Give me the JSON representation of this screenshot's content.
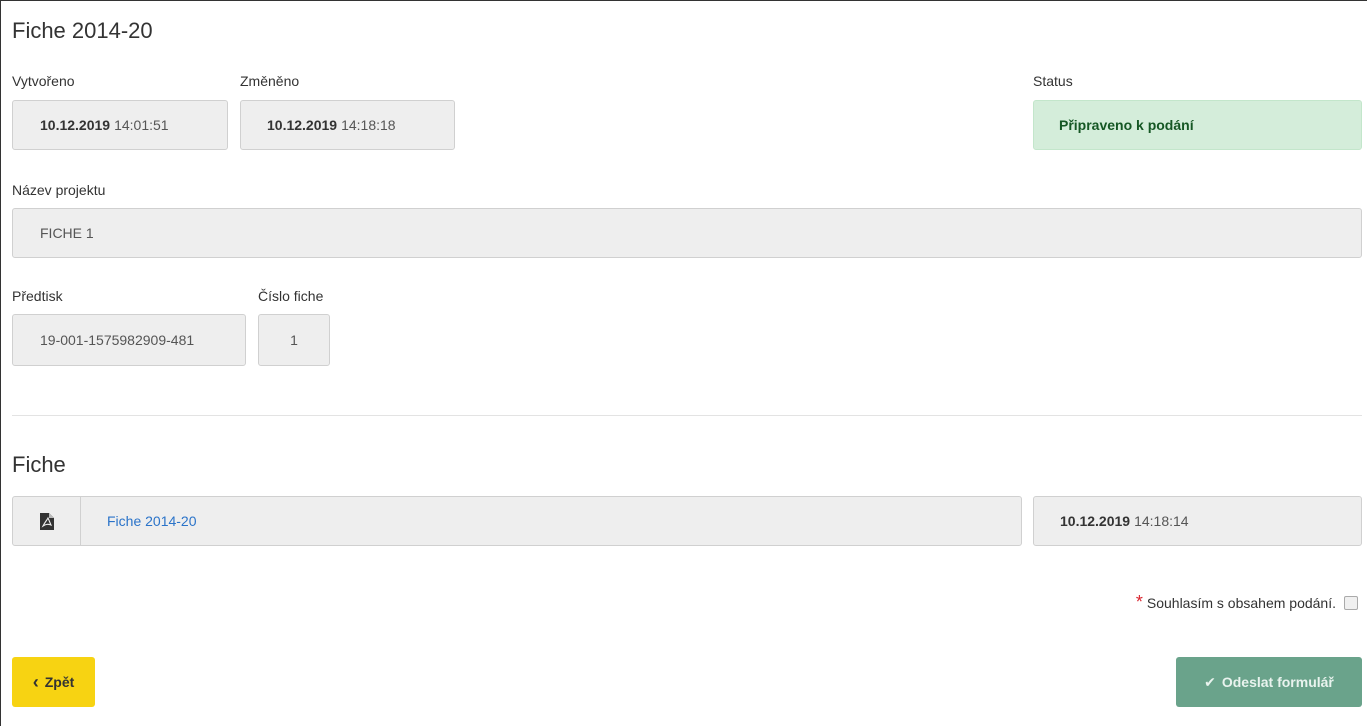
{
  "header": {
    "title": "Fiche 2014-20"
  },
  "created": {
    "label": "Vytvořeno",
    "date": "10.12.2019",
    "time": "14:01:51"
  },
  "changed": {
    "label": "Změněno",
    "date": "10.12.2019",
    "time": "14:18:18"
  },
  "status": {
    "label": "Status",
    "value": "Připraveno k podání"
  },
  "project": {
    "label": "Název projektu",
    "value": "FICHE 1"
  },
  "predtisk": {
    "label": "Předtisk",
    "value": "19-001-1575982909-481"
  },
  "cislo": {
    "label": "Číslo fiche",
    "value": "1"
  },
  "fiche_section": {
    "title": "Fiche",
    "file_link": "Fiche 2014-20",
    "file_date": "10.12.2019",
    "file_time": "14:18:14"
  },
  "agree": {
    "required_mark": "*",
    "label": "Souhlasím s obsahem podání."
  },
  "buttons": {
    "back_icon": "‹",
    "back_label": "Zpět",
    "send_icon": "✔",
    "send_label": "Odeslat formulář"
  }
}
